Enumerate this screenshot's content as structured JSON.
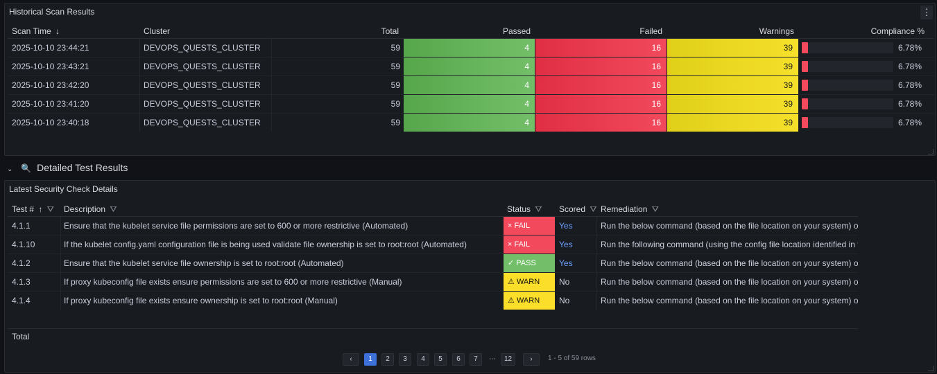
{
  "scan_panel": {
    "title": "Historical Scan Results",
    "menu": "⋮",
    "columns": {
      "scan_time": "Scan Time",
      "sort_icon": "↓",
      "cluster": "Cluster",
      "total": "Total",
      "passed": "Passed",
      "failed": "Failed",
      "warnings": "Warnings",
      "compliance": "Compliance %"
    },
    "rows": [
      {
        "time": "2025-10-10 23:44:21",
        "cluster": "DEVOPS_QUESTS_CLUSTER",
        "total": "59",
        "passed": "4",
        "failed": "16",
        "warnings": "39",
        "compliance": "6.78%",
        "compliance_value": 6.78
      },
      {
        "time": "2025-10-10 23:43:21",
        "cluster": "DEVOPS_QUESTS_CLUSTER",
        "total": "59",
        "passed": "4",
        "failed": "16",
        "warnings": "39",
        "compliance": "6.78%",
        "compliance_value": 6.78
      },
      {
        "time": "2025-10-10 23:42:20",
        "cluster": "DEVOPS_QUESTS_CLUSTER",
        "total": "59",
        "passed": "4",
        "failed": "16",
        "warnings": "39",
        "compliance": "6.78%",
        "compliance_value": 6.78
      },
      {
        "time": "2025-10-10 23:41:20",
        "cluster": "DEVOPS_QUESTS_CLUSTER",
        "total": "59",
        "passed": "4",
        "failed": "16",
        "warnings": "39",
        "compliance": "6.78%",
        "compliance_value": 6.78
      },
      {
        "time": "2025-10-10 23:40:18",
        "cluster": "DEVOPS_QUESTS_CLUSTER",
        "total": "59",
        "passed": "4",
        "failed": "16",
        "warnings": "39",
        "compliance": "6.78%",
        "compliance_value": 6.78
      }
    ],
    "colors": {
      "passed": "#73bf69",
      "failed": "#f2495c",
      "warnings": "#fade2a"
    }
  },
  "section": {
    "chevron": "⌄",
    "icon": "🔍",
    "title": "Detailed Test Results"
  },
  "detail_panel": {
    "title": "Latest Security Check Details",
    "columns": {
      "test": "Test #",
      "sort_icon": "↑",
      "description": "Description",
      "status": "Status",
      "scored": "Scored",
      "remediation": "Remediation",
      "filter_icon": "⛛"
    },
    "rows": [
      {
        "test": "4.1.1",
        "description": "Ensure that the kubelet service file permissions are set to 600 or more restrictive (Automated)",
        "status_icon": "×",
        "status": "FAIL",
        "status_kind": "fail",
        "scored": "Yes",
        "remediation": "Run the below command (based on the file location on your system) on th"
      },
      {
        "test": "4.1.10",
        "description": "If the kubelet config.yaml configuration file is being used validate file ownership is set to root:root (Automated)",
        "status_icon": "×",
        "status": "FAIL",
        "status_kind": "fail",
        "scored": "Yes",
        "remediation": "Run the following command (using the config file location identified in the"
      },
      {
        "test": "4.1.2",
        "description": "Ensure that the kubelet service file ownership is set to root:root (Automated)",
        "status_icon": "✓",
        "status": "PASS",
        "status_kind": "pass",
        "scored": "Yes",
        "remediation": "Run the below command (based on the file location on your system) on th"
      },
      {
        "test": "4.1.3",
        "description": "If proxy kubeconfig file exists ensure permissions are set to 600 or more restrictive (Manual)",
        "status_icon": "⚠",
        "status": "WARN",
        "status_kind": "warn",
        "scored": "No",
        "remediation": "Run the below command (based on the file location on your system) on th"
      },
      {
        "test": "4.1.4",
        "description": "If proxy kubeconfig file exists ensure ownership is set to root:root (Manual)",
        "status_icon": "⚠",
        "status": "WARN",
        "status_kind": "warn",
        "scored": "No",
        "remediation": "Run the below command (based on the file location on your system) on th"
      }
    ],
    "footer_total": "Total",
    "pagination": {
      "prev": "‹",
      "next": "›",
      "pages": [
        "1",
        "2",
        "3",
        "4",
        "5",
        "6",
        "7"
      ],
      "ellipsis": "⋯",
      "last": "12",
      "current": "1",
      "info": "1 - 5 of 59 rows"
    }
  }
}
